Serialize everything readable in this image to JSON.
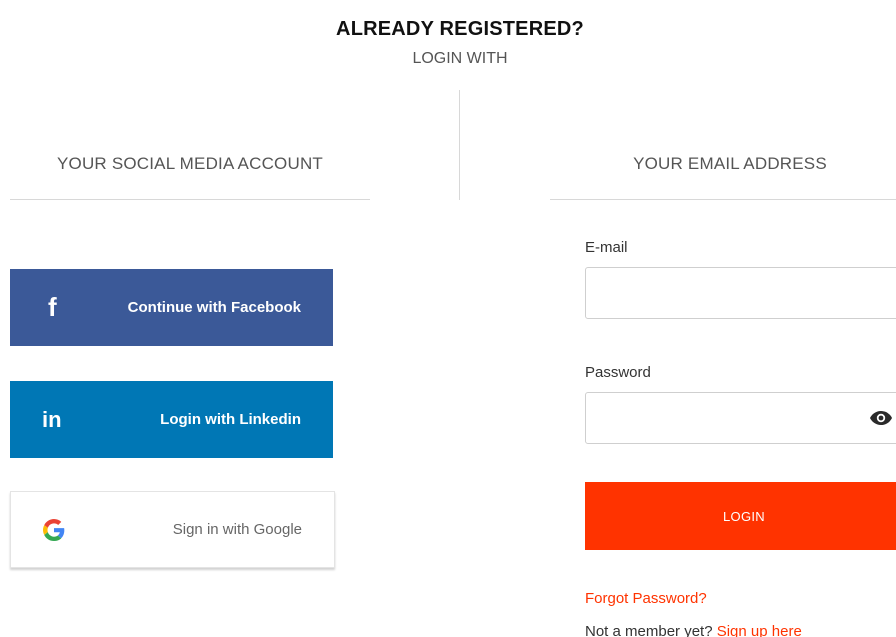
{
  "header": {
    "title": "ALREADY REGISTERED?",
    "subtitle": "LOGIN WITH"
  },
  "social": {
    "title": "YOUR SOCIAL MEDIA ACCOUNT",
    "facebook": {
      "label": "Continue with Facebook",
      "icon": "facebook-icon",
      "color": "#3b5998"
    },
    "linkedin": {
      "label": "Login with Linkedin",
      "icon": "linkedin-icon",
      "color": "#0077b5"
    },
    "google": {
      "label": "Sign in with Google",
      "icon": "google-icon",
      "color": "#ffffff"
    }
  },
  "email_login": {
    "title": "YOUR EMAIL ADDRESS",
    "email_label": "E-mail",
    "email_value": "",
    "password_label": "Password",
    "password_value": "",
    "password_toggle_icon": "eye-icon",
    "login_label": "LOGIN",
    "login_color": "#ff3300",
    "forgot_label": "Forgot Password?",
    "member_text": "Not a member yet? ",
    "signup_label": "Sign up here"
  }
}
